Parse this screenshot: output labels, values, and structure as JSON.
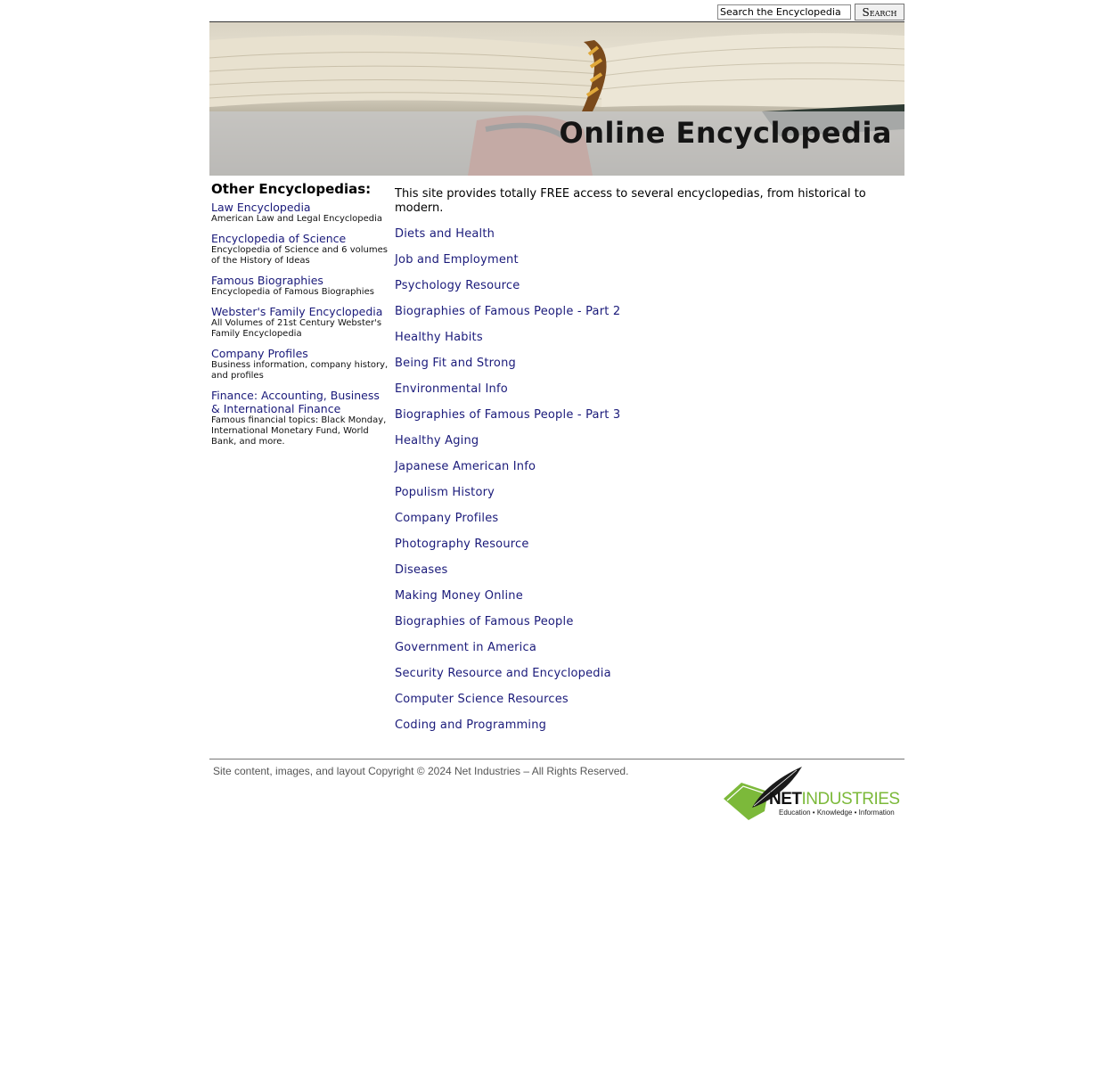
{
  "search": {
    "placeholder": "Search the Encyclopedia",
    "value": "Search the Encyclopedia",
    "button_label": "Search"
  },
  "banner": {
    "title": "Online Encyclopedia"
  },
  "sidebar": {
    "heading": "Other Encyclopedias:",
    "items": [
      {
        "label": "Law Encyclopedia",
        "description": "American Law and Legal Encyclopedia"
      },
      {
        "label": "Encyclopedia of Science",
        "description": "Encyclopedia of Science and 6 volumes of the History of Ideas"
      },
      {
        "label": "Famous Biographies",
        "description": "Encyclopedia of Famous Biographies"
      },
      {
        "label": "Webster's Family Encyclopedia",
        "description": "All Volumes of 21st Century Webster's Family Encyclopedia"
      },
      {
        "label": "Company Profiles",
        "description": "Business information, company history, and profiles"
      },
      {
        "label": "Finance: Accounting, Business & International Finance",
        "description": "Famous financial topics: Black Monday, International Monetary Fund, World Bank, and more."
      }
    ]
  },
  "main": {
    "intro": "This site provides totally FREE access to several encyclopedias, from historical to modern.",
    "topics": [
      "Diets and Health",
      "Job and Employment",
      "Psychology Resource",
      "Biographies of Famous People - Part 2",
      "Healthy Habits",
      "Being Fit and Strong",
      "Environmental Info",
      "Biographies of Famous People - Part 3",
      "Healthy Aging",
      "Japanese American Info",
      "Populism History",
      "Company Profiles",
      "Photography Resource",
      "Diseases",
      "Making Money Online",
      "Biographies of Famous People",
      "Government in America",
      "Security Resource and Encyclopedia",
      "Computer Science Resources",
      "Coding and Programming"
    ]
  },
  "footer": {
    "copyright": "Site content, images, and layout Copyright © 2024 Net Industries – All Rights Reserved.",
    "logo_net": "NET",
    "logo_industries": "INDUSTRIES",
    "logo_tagline": "Education • Knowledge • Information"
  }
}
